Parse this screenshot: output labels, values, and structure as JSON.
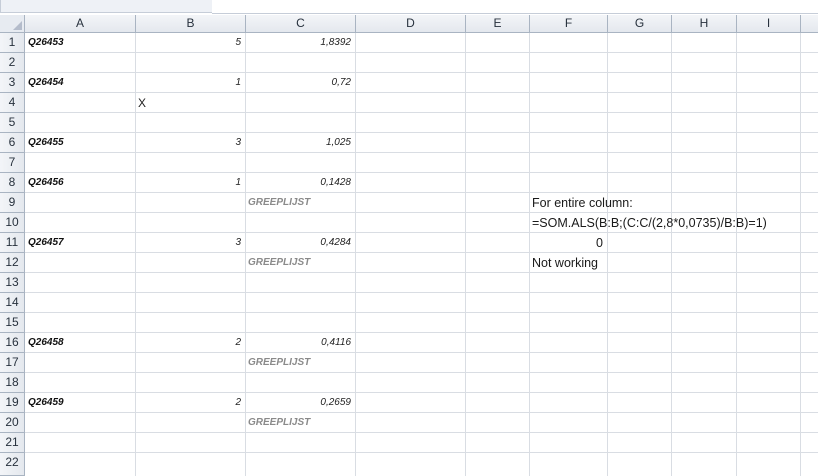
{
  "columns": [
    "A",
    "B",
    "C",
    "D",
    "E",
    "F",
    "G",
    "H",
    "I"
  ],
  "rows": [
    "1",
    "2",
    "3",
    "4",
    "5",
    "6",
    "7",
    "8",
    "9",
    "10",
    "11",
    "12",
    "13",
    "14",
    "15",
    "16",
    "17",
    "18",
    "19",
    "20",
    "21",
    "22"
  ],
  "cells": {
    "A1": "Q26453",
    "B1": "5",
    "C1": "1,8392",
    "A3": "Q26454",
    "B3": "1",
    "C3": "0,72",
    "B4": "X",
    "A6": "Q26455",
    "B6": "3",
    "C6": "1,025",
    "A8": "Q26456",
    "B8": "1",
    "C8": "0,1428",
    "C9": "GREEPLIJST",
    "F9": "For entire column:",
    "F10": "=SOM.ALS(B:B;(C:C/(2,8*0,0735)/B:B)=1)",
    "A11": "Q26457",
    "B11": "3",
    "C11": "0,4284",
    "F11": "0",
    "C12": "GREEPLIJST",
    "F12": "Not working",
    "A16": "Q26458",
    "B16": "2",
    "C16": "0,4116",
    "C17": "GREEPLIJST",
    "A19": "Q26459",
    "B19": "2",
    "C19": "0,2659",
    "C20": "GREEPLIJST"
  }
}
